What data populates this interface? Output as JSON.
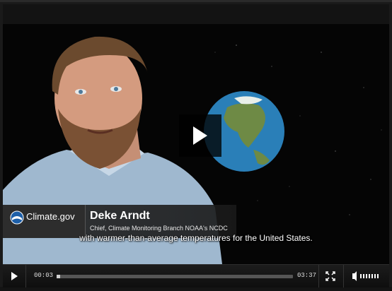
{
  "video": {
    "brand_label": "Climate.gov",
    "speaker_name": "Deke Arndt",
    "speaker_title": "Chief, Climate Monitoring Branch NOAA's NCDC",
    "caption": "with warmer-than-average temperatures for the United States."
  },
  "controls": {
    "current_time": "00:03",
    "duration": "03:37",
    "progress": 0.014,
    "volume_level": 1.0
  },
  "icons": {
    "big_play": "play-icon",
    "play": "play-icon",
    "fullscreen": "fullscreen-icon",
    "volume": "volume-icon"
  },
  "colors": {
    "background": "#050505",
    "control_bar": "#141414",
    "seek_track": "#555555",
    "seek_fill": "#cfcfcf",
    "globe_ocean": "#2a7fb8"
  }
}
